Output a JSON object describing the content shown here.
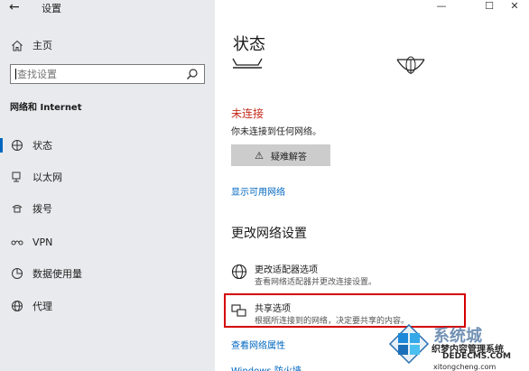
{
  "window": {
    "title": "设置",
    "back_icon": "←",
    "controls": {
      "minimize": "—",
      "maximize": "☐",
      "close": "✕"
    }
  },
  "sidebar": {
    "home_label": "主页",
    "search_placeholder": "查找设置",
    "section_title": "网络和 Internet",
    "items": [
      {
        "label": "状态",
        "icon": "status-icon",
        "active": true
      },
      {
        "label": "以太网",
        "icon": "ethernet-icon",
        "active": false
      },
      {
        "label": "拨号",
        "icon": "dialup-icon",
        "active": false
      },
      {
        "label": "VPN",
        "icon": "vpn-icon",
        "active": false
      },
      {
        "label": "数据使用量",
        "icon": "data-usage-icon",
        "active": false
      },
      {
        "label": "代理",
        "icon": "proxy-icon",
        "active": false
      }
    ]
  },
  "main": {
    "title": "状态",
    "status": "未连接",
    "status_desc": "你未连接到任何网络。",
    "troubleshoot_label": "疑难解答",
    "show_networks_link": "显示可用网络",
    "change_heading": "更改网络设置",
    "options": [
      {
        "title": "更改适配器选项",
        "desc": "查看网络适配器并更改连接设置。",
        "icon": "adapter-icon"
      },
      {
        "title": "共享选项",
        "desc": "根据所连接到的网络，决定要共享的内容。",
        "icon": "sharing-icon"
      }
    ],
    "view_properties_link": "查看网络属性",
    "firewall_link": "Windows 防火墙"
  },
  "watermark": {
    "brand": "系统城",
    "line2": "织梦内容管理系统",
    "line3": "DEDECMS.COM",
    "line4": "xitongcheng.com"
  },
  "colors": {
    "accent": "#0067c0",
    "error": "#c42b1c",
    "highlight": "#d40000",
    "sidebar_bg": "#e9eaed"
  }
}
